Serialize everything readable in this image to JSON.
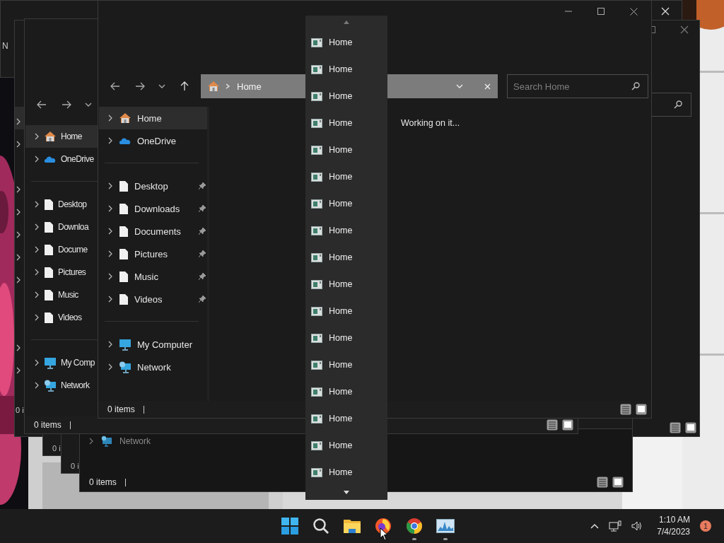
{
  "edge_fragment": "N",
  "window_a": {
    "status_text": "0 i"
  },
  "bottom_windows": [
    {
      "kind": "stub",
      "status_text": "0 i"
    },
    {
      "kind": "stub",
      "status_text": "0 i"
    },
    {
      "kind": "explorer",
      "sidebar": [
        {
          "kind": "network",
          "label": "Network"
        }
      ],
      "status_text": "0 items"
    }
  ],
  "windows": [
    {
      "kind": "behind",
      "sidebar_groups": [
        [
          {
            "kind": "home",
            "label": "Home",
            "selected": true
          },
          {
            "kind": "cloud",
            "label": "OneDrive",
            "selected": false
          }
        ],
        [
          {
            "kind": "file",
            "label": "Desktop",
            "selected": false
          },
          {
            "kind": "file",
            "label": "Downloa",
            "selected": false
          },
          {
            "kind": "file",
            "label": "Docume",
            "selected": false
          },
          {
            "kind": "file",
            "label": "Pictures",
            "selected": false
          },
          {
            "kind": "file",
            "label": "Music",
            "selected": false
          },
          {
            "kind": "file",
            "label": "Videos",
            "selected": false
          }
        ],
        [
          {
            "kind": "computer",
            "label": "My Comp",
            "selected": false
          },
          {
            "kind": "network",
            "label": "Network",
            "selected": false
          }
        ]
      ],
      "status_text": "0 items"
    },
    {
      "kind": "front",
      "address": {
        "segments": [
          "Home"
        ]
      },
      "search": {
        "placeholder": "Search Home"
      },
      "content_status": "Working on it...",
      "sidebar_groups": [
        [
          {
            "kind": "home",
            "label": "Home",
            "selected": true,
            "pinned": false
          },
          {
            "kind": "cloud",
            "label": "OneDrive",
            "selected": false,
            "pinned": false
          }
        ],
        [
          {
            "kind": "file",
            "label": "Desktop",
            "selected": false,
            "pinned": true
          },
          {
            "kind": "file",
            "label": "Downloads",
            "selected": false,
            "pinned": true
          },
          {
            "kind": "file",
            "label": "Documents",
            "selected": false,
            "pinned": true
          },
          {
            "kind": "file",
            "label": "Pictures",
            "selected": false,
            "pinned": true
          },
          {
            "kind": "file",
            "label": "Music",
            "selected": false,
            "pinned": true
          },
          {
            "kind": "file",
            "label": "Videos",
            "selected": false,
            "pinned": true
          }
        ],
        [
          {
            "kind": "computer",
            "label": "My Computer",
            "selected": false,
            "pinned": false
          },
          {
            "kind": "network",
            "label": "Network",
            "selected": false,
            "pinned": false
          }
        ]
      ],
      "status_text": "0 items"
    }
  ],
  "dropdown": {
    "items": [
      {
        "label": "Home"
      },
      {
        "label": "Home"
      },
      {
        "label": "Home"
      },
      {
        "label": "Home"
      },
      {
        "label": "Home"
      },
      {
        "label": "Home"
      },
      {
        "label": "Home"
      },
      {
        "label": "Home"
      },
      {
        "label": "Home"
      },
      {
        "label": "Home"
      },
      {
        "label": "Home"
      },
      {
        "label": "Home"
      },
      {
        "label": "Home"
      },
      {
        "label": "Home"
      },
      {
        "label": "Home"
      },
      {
        "label": "Home"
      },
      {
        "label": "Home"
      }
    ]
  },
  "taskbar": {
    "apps": [
      {
        "kind": "start",
        "running": false
      },
      {
        "kind": "search",
        "running": false
      },
      {
        "kind": "folder",
        "running": false
      },
      {
        "kind": "firefox",
        "running": false
      },
      {
        "kind": "chrome",
        "running": true
      },
      {
        "kind": "monitor",
        "running": true
      }
    ],
    "time": "1:10 AM",
    "date": "7/4/2023",
    "notification_count": "1"
  }
}
